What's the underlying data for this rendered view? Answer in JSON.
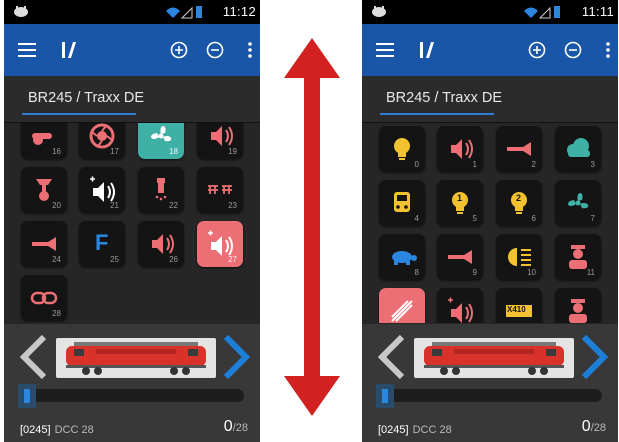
{
  "left": {
    "status": {
      "time": "11:12"
    },
    "loco_name": "BR245 / Traxx DE",
    "functions": [
      {
        "num": "16",
        "icon": "whistle-icon",
        "color": "#ec6f75",
        "bg": "dark"
      },
      {
        "num": "17",
        "icon": "turbo-fan-icon",
        "color": "#ec6f75",
        "bg": "dark"
      },
      {
        "num": "18",
        "icon": "fan-icon",
        "color": "#ffffff",
        "bg": "teal"
      },
      {
        "num": "19",
        "icon": "speaker-icon",
        "color": "#ec6f75",
        "bg": "dark"
      },
      {
        "num": "20",
        "icon": "coupler-icon",
        "color": "#ec6f75",
        "bg": "dark"
      },
      {
        "num": "21",
        "icon": "speaker-plus-icon",
        "color": "#ffffff",
        "bg": "dark"
      },
      {
        "num": "22",
        "icon": "sander-icon",
        "color": "#ec6f75",
        "bg": "dark"
      },
      {
        "num": "23",
        "icon": "pantograph-icon",
        "color": "#ec6f75",
        "bg": "dark"
      },
      {
        "num": "24",
        "icon": "horn-icon",
        "color": "#ec6f75",
        "bg": "dark"
      },
      {
        "num": "25",
        "icon": "f-letter-icon",
        "color": "#2a86de",
        "bg": "dark",
        "text": "F"
      },
      {
        "num": "26",
        "icon": "speaker-icon",
        "color": "#ec6f75",
        "bg": "dark"
      },
      {
        "num": "27",
        "icon": "speaker-plus-icon",
        "color": "#ffffff",
        "bg": "pink"
      },
      {
        "num": "28",
        "icon": "link-icon",
        "color": "#ec6f75",
        "bg": "dark"
      }
    ],
    "address": "[0245]",
    "protocol": "DCC 28",
    "speed": "0",
    "max": "/28",
    "speed_fraction": 0
  },
  "right": {
    "status": {
      "time": "11:11"
    },
    "loco_name": "BR245 / Traxx DE",
    "functions": [
      {
        "num": "0",
        "icon": "headlight-bulb-icon",
        "color": "#f2c230",
        "bg": "dark"
      },
      {
        "num": "1",
        "icon": "speaker-icon",
        "color": "#ec6f75",
        "bg": "dark"
      },
      {
        "num": "2",
        "icon": "horn-icon",
        "color": "#ec6f75",
        "bg": "dark"
      },
      {
        "num": "3",
        "icon": "cloud-icon",
        "color": "#3fb0a6",
        "bg": "dark"
      },
      {
        "num": "4",
        "icon": "cab-light-icon",
        "color": "#f2c230",
        "bg": "dark"
      },
      {
        "num": "5",
        "icon": "bulb-1-icon",
        "color": "#f2c230",
        "bg": "dark",
        "text": "1"
      },
      {
        "num": "6",
        "icon": "bulb-2-icon",
        "color": "#f2c230",
        "bg": "dark",
        "text": "2"
      },
      {
        "num": "7",
        "icon": "fan-icon",
        "color": "#3fb0a6",
        "bg": "dark"
      },
      {
        "num": "8",
        "icon": "turtle-icon",
        "color": "#2a86de",
        "bg": "dark"
      },
      {
        "num": "9",
        "icon": "horn-icon",
        "color": "#ec6f75",
        "bg": "dark"
      },
      {
        "num": "10",
        "icon": "high-beam-icon",
        "color": "#f2c230",
        "bg": "dark"
      },
      {
        "num": "11",
        "icon": "conductor-icon",
        "color": "#ec6f75",
        "bg": "dark"
      },
      {
        "num": "",
        "icon": "shunting-icon",
        "color": "#ffffff",
        "bg": "pink"
      },
      {
        "num": "",
        "icon": "speaker-plus-icon",
        "color": "#ec6f75",
        "bg": "dark"
      },
      {
        "num": "",
        "icon": "x410-sign-icon",
        "color": "#f2c230",
        "bg": "dark",
        "text": "X410"
      },
      {
        "num": "",
        "icon": "conductor-icon",
        "color": "#ec6f75",
        "bg": "dark"
      }
    ],
    "address": "[0245]",
    "protocol": "DCC 28",
    "speed": "0",
    "max": "/28",
    "speed_fraction": 0
  },
  "colors": {
    "accent": "#1a56a8",
    "highlight": "#2a86de",
    "arrow": "#d32020",
    "function_red": "#ec6f75",
    "function_yellow": "#f2c230",
    "function_teal": "#3fb0a6"
  }
}
